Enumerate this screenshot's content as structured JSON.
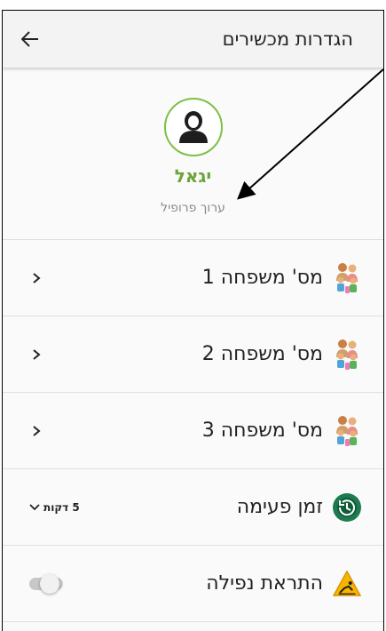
{
  "header": {
    "title": "הגדרות מכשירים",
    "back_icon": "arrow-left-icon"
  },
  "profile": {
    "name": "יגאל",
    "edit_label": "ערוך פרופיל",
    "avatar_icon": "person-icon",
    "accent": "#7cc142"
  },
  "settings": {
    "family_1": {
      "label": "מס' משפחה 1",
      "icon": "family-icon"
    },
    "family_2": {
      "label": "מס' משפחה 2",
      "icon": "family-icon"
    },
    "family_3": {
      "label": "מס' משפחה 3",
      "icon": "family-icon"
    },
    "pulse": {
      "label": "זמן פעימה",
      "value": "5 דקות",
      "icon": "history-clock-icon"
    },
    "fall": {
      "label": "התראת נפילה",
      "icon": "fall-warning-icon",
      "enabled": false
    }
  }
}
